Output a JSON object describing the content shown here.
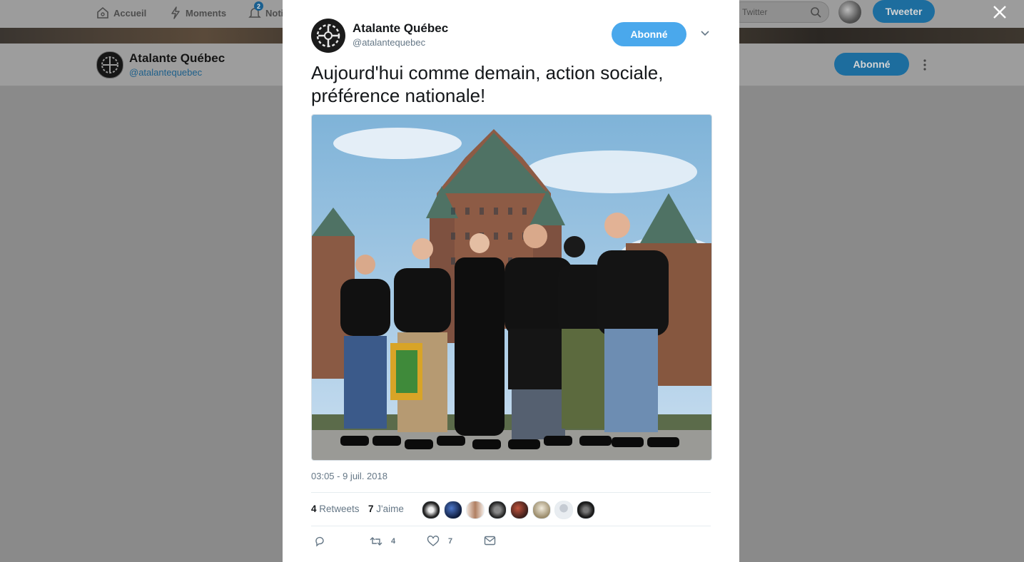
{
  "nav": {
    "home": "Accueil",
    "moments": "Moments",
    "notifications": "Noti",
    "notifications_badge": "2",
    "search_placeholder": "Twitter",
    "tweet_button": "Tweeter"
  },
  "profile": {
    "name": "Atalante Québec",
    "handle": "@atalantequebec",
    "follow_label": "Abonné"
  },
  "tweet": {
    "author_name": "Atalante Québec",
    "author_handle": "@atalantequebec",
    "follow_label": "Abonné",
    "text": "Aujourd'hui comme demain, action sociale, préférence nationale!",
    "timestamp": "03:05 - 9 juil. 2018",
    "retweets_count": "4",
    "retweets_label": "Retweets",
    "likes_count": "7",
    "likes_label": "J'aime",
    "reply_count": "",
    "retweet_action_count": "4",
    "like_action_count": "7"
  },
  "colors": {
    "accent": "#4aa8ec",
    "text": "#14171a",
    "muted": "#657786",
    "overlay": "#8a8a8a"
  },
  "icons": [
    "home-icon",
    "moments-icon",
    "bell-icon",
    "search-icon",
    "close-icon",
    "chevron-down-icon",
    "more-icon",
    "reply-icon",
    "retweet-icon",
    "heart-icon",
    "message-icon"
  ]
}
